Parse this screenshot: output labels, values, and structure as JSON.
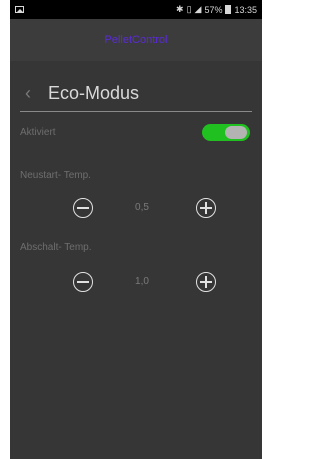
{
  "status_bar": {
    "battery_percent": "57%",
    "time": "13:35",
    "icons": [
      "image-icon",
      "bluetooth-icon",
      "vibrate-icon",
      "signal-icon",
      "battery-icon"
    ]
  },
  "app_bar": {
    "title": "PelletControl"
  },
  "page": {
    "title": "Eco-Modus"
  },
  "settings": {
    "aktiviert": {
      "label": "Aktiviert",
      "enabled": true
    },
    "neustart": {
      "label": "Neustart- Temp.",
      "value": "0,5"
    },
    "abschalt": {
      "label": "Abschalt- Temp.",
      "value": "1,0"
    }
  },
  "colors": {
    "accent_toggle": "#1fc01f",
    "app_title": "#5a2bd6",
    "background": "#363636"
  }
}
